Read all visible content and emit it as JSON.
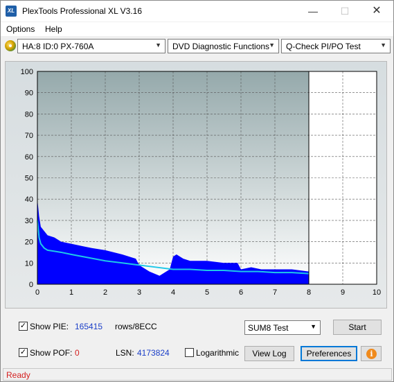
{
  "window": {
    "title": "PlexTools Professional XL V3.16",
    "app_icon_text": "XL",
    "minimize_glyph": "—",
    "maximize_glyph": "☐",
    "close_glyph": "✕"
  },
  "menu": {
    "options": "Options",
    "help": "Help"
  },
  "toolbar": {
    "drive": "HA:8 ID:0  PX-760A",
    "function": "DVD Diagnostic Functions",
    "test": "Q-Check PI/PO Test",
    "drive_icon": "disc-drive-icon"
  },
  "chart_data": {
    "type": "area",
    "x_ticks": [
      "0",
      "1",
      "2",
      "3",
      "4",
      "5",
      "6",
      "7",
      "8",
      "9",
      "10"
    ],
    "y_ticks": [
      "0",
      "10",
      "20",
      "30",
      "40",
      "50",
      "60",
      "70",
      "80",
      "90",
      "100"
    ],
    "xlim": [
      0,
      10
    ],
    "ylim": [
      0,
      100
    ],
    "grid": true,
    "test_end_x": 8,
    "series": [
      {
        "color": "#0000ff",
        "x": [
          0.0,
          0.05,
          0.1,
          0.2,
          0.3,
          0.5,
          0.7,
          1.0,
          1.3,
          1.6,
          2.0,
          2.5,
          2.9,
          3.0,
          3.1,
          3.3,
          3.6,
          3.9,
          4.0,
          4.1,
          4.3,
          4.5,
          5.0,
          5.5,
          5.9,
          6.0,
          6.3,
          6.6,
          7.0,
          7.5,
          8.0
        ],
        "values": [
          40,
          32,
          27,
          25,
          23,
          22,
          20,
          19,
          18,
          17,
          16,
          14,
          12,
          9,
          8,
          6,
          4,
          7,
          13,
          14,
          12,
          11,
          11,
          10,
          10,
          7,
          8,
          7,
          7,
          7,
          6
        ]
      },
      {
        "color": "#1ec8e8",
        "x": [
          0.0,
          0.05,
          0.1,
          0.2,
          0.3,
          0.5,
          0.7,
          1.0,
          1.5,
          2.0,
          2.5,
          3.0,
          3.5,
          4.0,
          4.5,
          5.0,
          5.5,
          6.0,
          6.5,
          7.0,
          7.5,
          8.0
        ],
        "values": [
          30,
          22,
          19,
          17,
          16,
          15.5,
          15,
          14,
          12.5,
          11,
          10,
          9,
          8,
          7,
          7,
          6.5,
          6.5,
          6,
          6,
          5.5,
          5.5,
          5
        ]
      }
    ]
  },
  "bottom": {
    "show_pie_label": "Show PIE:",
    "pie_value": "165415",
    "rows_label": "rows/8ECC",
    "show_pof_label": "Show POF:",
    "pof_value": "0",
    "lsn_label": "LSN:",
    "lsn_value": "4173824",
    "logarithmic_label": "Logarithmic",
    "sum_select": "SUM8 Test",
    "start_button": "Start",
    "viewlog_button": "View Log",
    "preferences_button": "Preferences",
    "check_glyph": "✓",
    "info_glyph": "i",
    "show_pie_checked": true,
    "show_pof_checked": true,
    "logarithmic_checked": false
  },
  "status": {
    "text": "Ready"
  }
}
